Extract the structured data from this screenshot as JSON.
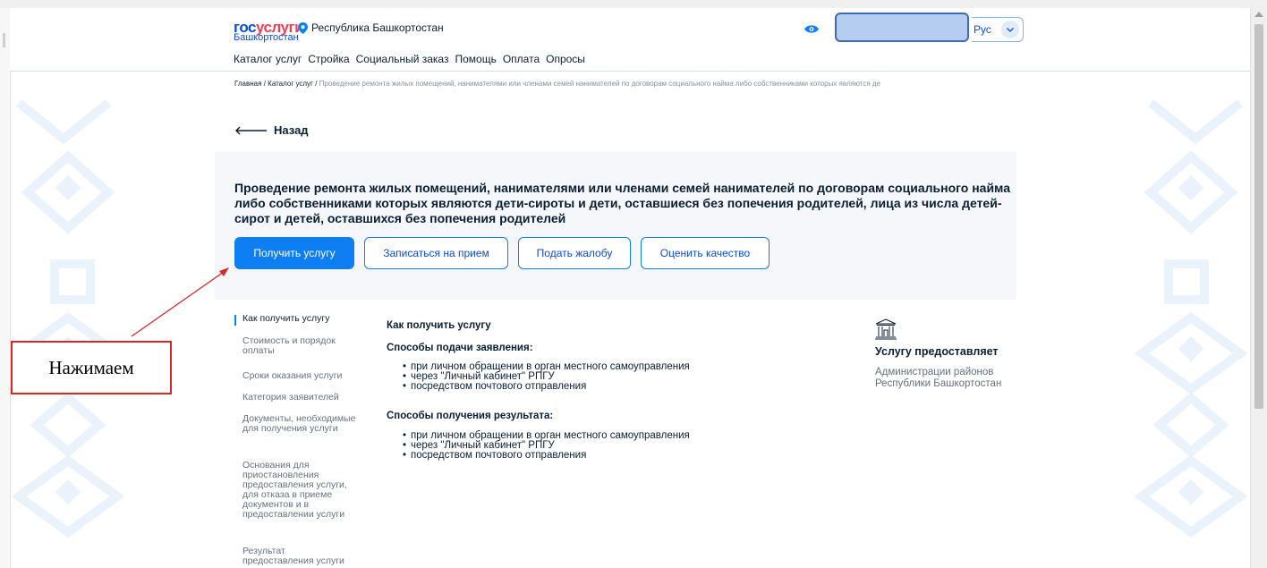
{
  "header": {
    "logo_part1": "гос",
    "logo_part2": "услуги",
    "logo_region": "Башкортостан",
    "region": "Республика Башкортостан",
    "language": "Рус",
    "nav": [
      "Каталог услуг",
      "Стройка",
      "Социальный заказ",
      "Помощь",
      "Оплата",
      "Опросы"
    ]
  },
  "breadcrumb": {
    "home": "Главная",
    "separator": "/",
    "catalog": "Каталог услуг",
    "current": "Проведение ремонта жилых помещений, нанимателями или членами семей нанимателей по договорам социального найма либо собственниками которых являются де"
  },
  "back_label": "Назад",
  "service": {
    "title": "Проведение ремонта жилых помещений, нанимателями или членами семей нанимателей по договорам социального найма либо собственниками которых являются дети-сироты и дети, оставшиеся без попечения родителей, лица из числа детей-сирот и детей, оставшихся без попечения родителей",
    "buttons": {
      "get": "Получить услугу",
      "appoint": "Записаться на прием",
      "complain": "Подать жалобу",
      "rate": "Оценить качество"
    }
  },
  "sidenav": [
    "Как получить услугу",
    "Стоимость и порядок оплаты",
    "Сроки оказания услуги",
    "Категория заявителей",
    "Документы, необходимые для получения услуги",
    "Основания для приостановления предоставления услуги, для отказа в приеме документов и в предоставлении услуги",
    "Результат предоставления услуги"
  ],
  "content": {
    "heading": "Как получить услугу",
    "submit_heading": "Способы подачи заявления:",
    "submit_items": [
      "при личном обращении в орган местного самоуправления",
      "через \"Личный кабинет\" РПГУ",
      "посредством почтового отправления"
    ],
    "result_heading": "Способы получения результата:",
    "result_items": [
      "при личном обращении в орган местного самоуправления",
      "через \"Личный кабинет\" РПГУ",
      "посредством почтового отправления"
    ]
  },
  "provider": {
    "title": "Услугу предоставляет",
    "org": "Администрации районов Республики Башкортостан"
  },
  "annotation": {
    "label": "Нажимаем",
    "color": "#d62828"
  },
  "colors": {
    "primary": "#0d7ff2",
    "brand_blue": "#0d4cd3",
    "brand_red": "#ee3f58",
    "text": "#0b1f33",
    "muted": "#66727f"
  }
}
